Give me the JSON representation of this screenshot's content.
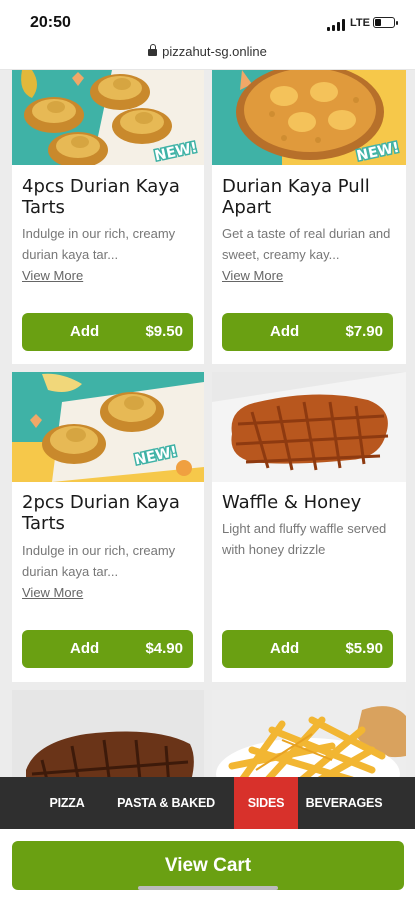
{
  "status_bar": {
    "time": "20:50",
    "network": "LTE",
    "battery_level": 0.35
  },
  "browser": {
    "url": "pizzahut-sg.online"
  },
  "products": [
    {
      "title": "4pcs Durian Kaya Tarts",
      "desc": "Indulge in our rich, creamy durian kaya tar...",
      "more": "View More",
      "add_label": "Add",
      "price": "$9.50",
      "badge": "NEW!"
    },
    {
      "title": "Durian Kaya Pull Apart",
      "desc": "Get a taste of real durian and sweet, creamy kay...",
      "more": "View More",
      "add_label": "Add",
      "price": "$7.90",
      "badge": "NEW!"
    },
    {
      "title": "2pcs Durian Kaya Tarts",
      "desc": "Indulge in our rich, creamy durian kaya tar...",
      "more": "View More",
      "add_label": "Add",
      "price": "$4.90",
      "badge": "NEW!"
    },
    {
      "title": "Waffle & Honey",
      "desc": "Light and fluffy waffle served with honey drizzle",
      "add_label": "Add",
      "price": "$5.90"
    }
  ],
  "categories": [
    "PIZZA",
    "PASTA & BAKED RICE",
    "SIDES",
    "BEVERAGES"
  ],
  "active_category": "SIDES",
  "cart": {
    "label": "View Cart"
  },
  "colors": {
    "accent_green": "#6aa012",
    "active_tab_red": "#d8312b",
    "tabbar_dark": "#2f2f2f"
  }
}
